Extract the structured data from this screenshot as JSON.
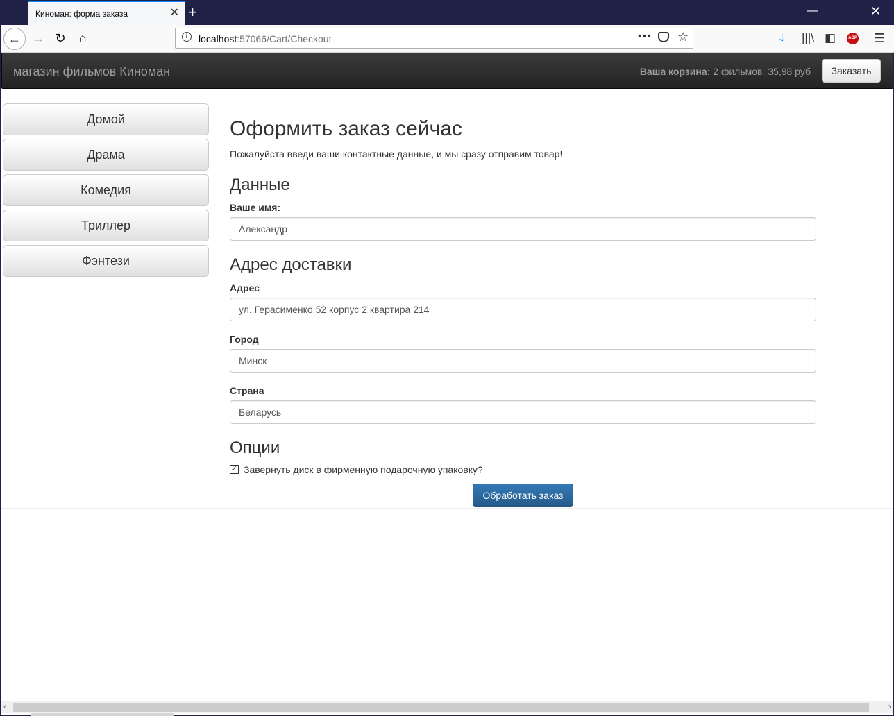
{
  "browser": {
    "tab_title": "Киноман: форма заказа",
    "tab_close_glyph": "✕",
    "new_tab_glyph": "+",
    "url_host": "localhost",
    "url_rest": ":57066/Cart/Checkout",
    "url_dots": "•••",
    "min_glyph": "—",
    "close_glyph": "✕"
  },
  "navbar": {
    "brand": "магазин фильмов Киноман",
    "cart_label": "Ваша корзина:",
    "cart_value": " 2 фильмов, 35,98 руб",
    "checkout_button": "Заказать"
  },
  "sidebar": {
    "items": [
      {
        "label": "Домой"
      },
      {
        "label": "Драма"
      },
      {
        "label": "Комедия"
      },
      {
        "label": "Триллер"
      },
      {
        "label": "Фэнтези"
      }
    ]
  },
  "form": {
    "title": "Оформить заказ сейчас",
    "intro": "Пожалуйста введи ваши контактные данные, и мы сразу отправим товар!",
    "section_details": "Данные",
    "name_label": "Ваше имя:",
    "name_value": "Александр",
    "section_address": "Адрес доставки",
    "address_label": "Адрес",
    "address_value": "ул. Герасименко 52 корпус 2 квартира 214",
    "city_label": "Город",
    "city_value": "Минск",
    "country_label": "Страна",
    "country_value": "Беларусь",
    "section_options": "Опции",
    "giftwrap_label": "Завернуть диск в фирменную подарочную упаковку?",
    "giftwrap_checked": true,
    "submit": "Обработать заказ"
  },
  "colors": {
    "tabstrip": "#1f2147",
    "navbar": "#222222",
    "primary": "#337ab7"
  },
  "icons": [
    "back-icon",
    "forward-icon",
    "reload-icon",
    "home-icon",
    "info-icon",
    "page-actions-icon",
    "pocket-icon",
    "bookmark-star-icon",
    "download-icon",
    "library-icon",
    "sidebar-icon",
    "adblock-icon",
    "hamburger-menu-icon"
  ]
}
